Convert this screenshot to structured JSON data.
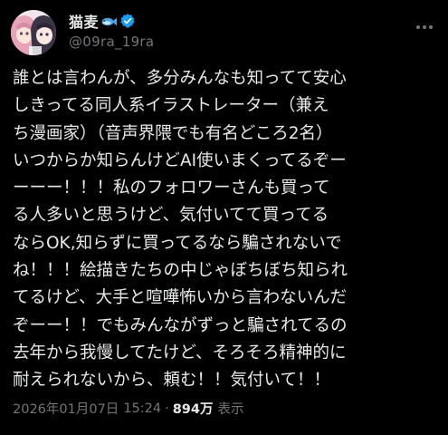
{
  "author": {
    "display_name": "猫麦",
    "handle": "@09ra_19ra",
    "avatar_icon": "anime-girls-avatar",
    "name_emoji_icon": "fish-icon",
    "verified_icon": "verified-badge-icon",
    "verified_color": "#1d9bf0"
  },
  "tweet": {
    "lines": [
      "誰とは言わんが、多分みんなも知ってて安心",
      "しきってる同人系イラストレーター（兼え",
      "ち漫画家）（音声界隈でも有名どころ2名）",
      "いつからか知らんけどAI使いまくってるぞー",
      "ーーー！！！私のフォロワーさんも買って",
      "る人多いと思うけど、気付いてて買ってる",
      "ならOK,知らずに買ってるなら騙されないで",
      "ね！！！絵描きたちの中じゃぼちぼち知られ",
      "てるけど、大手と喧嘩怖いから言わないんだ",
      "ぞーー！！でもみんながずっと騙されてるの",
      "去年から我慢してたけど、そろそろ精神的に",
      "耐えられないから、頼む！！気付いて！！"
    ],
    "date": "2026年01月07日",
    "time": "15:24",
    "separator": "·",
    "views_count": "894万",
    "views_label": "表示"
  },
  "more_icon": "more-options-icon"
}
